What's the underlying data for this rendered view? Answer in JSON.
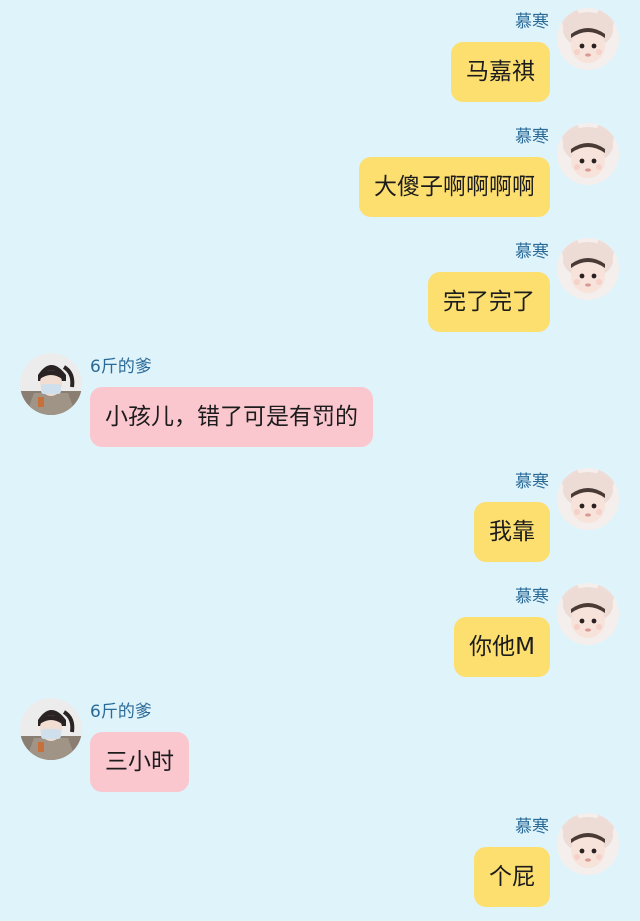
{
  "colors": {
    "background": "#dff3fb",
    "self_bubble": "#fddf6f",
    "other_bubble": "#fbc7cf",
    "name_text": "#2a6a97"
  },
  "messages": [
    {
      "sender": "慕寒",
      "text": "马嘉祺",
      "side": "right"
    },
    {
      "sender": "慕寒",
      "text": "大傻子啊啊啊啊",
      "side": "right"
    },
    {
      "sender": "慕寒",
      "text": "完了完了",
      "side": "right"
    },
    {
      "sender": "6斤的爹",
      "text": "小孩儿，错了可是有罚的",
      "side": "left"
    },
    {
      "sender": "慕寒",
      "text": "我靠",
      "side": "right"
    },
    {
      "sender": "慕寒",
      "text": "你他M",
      "side": "right"
    },
    {
      "sender": "6斤的爹",
      "text": "三小时",
      "side": "left"
    },
    {
      "sender": "慕寒",
      "text": "个屁",
      "side": "right"
    }
  ],
  "avatars": {
    "self": "baby-bunny-hat-avatar",
    "other": "masked-boy-avatar"
  }
}
